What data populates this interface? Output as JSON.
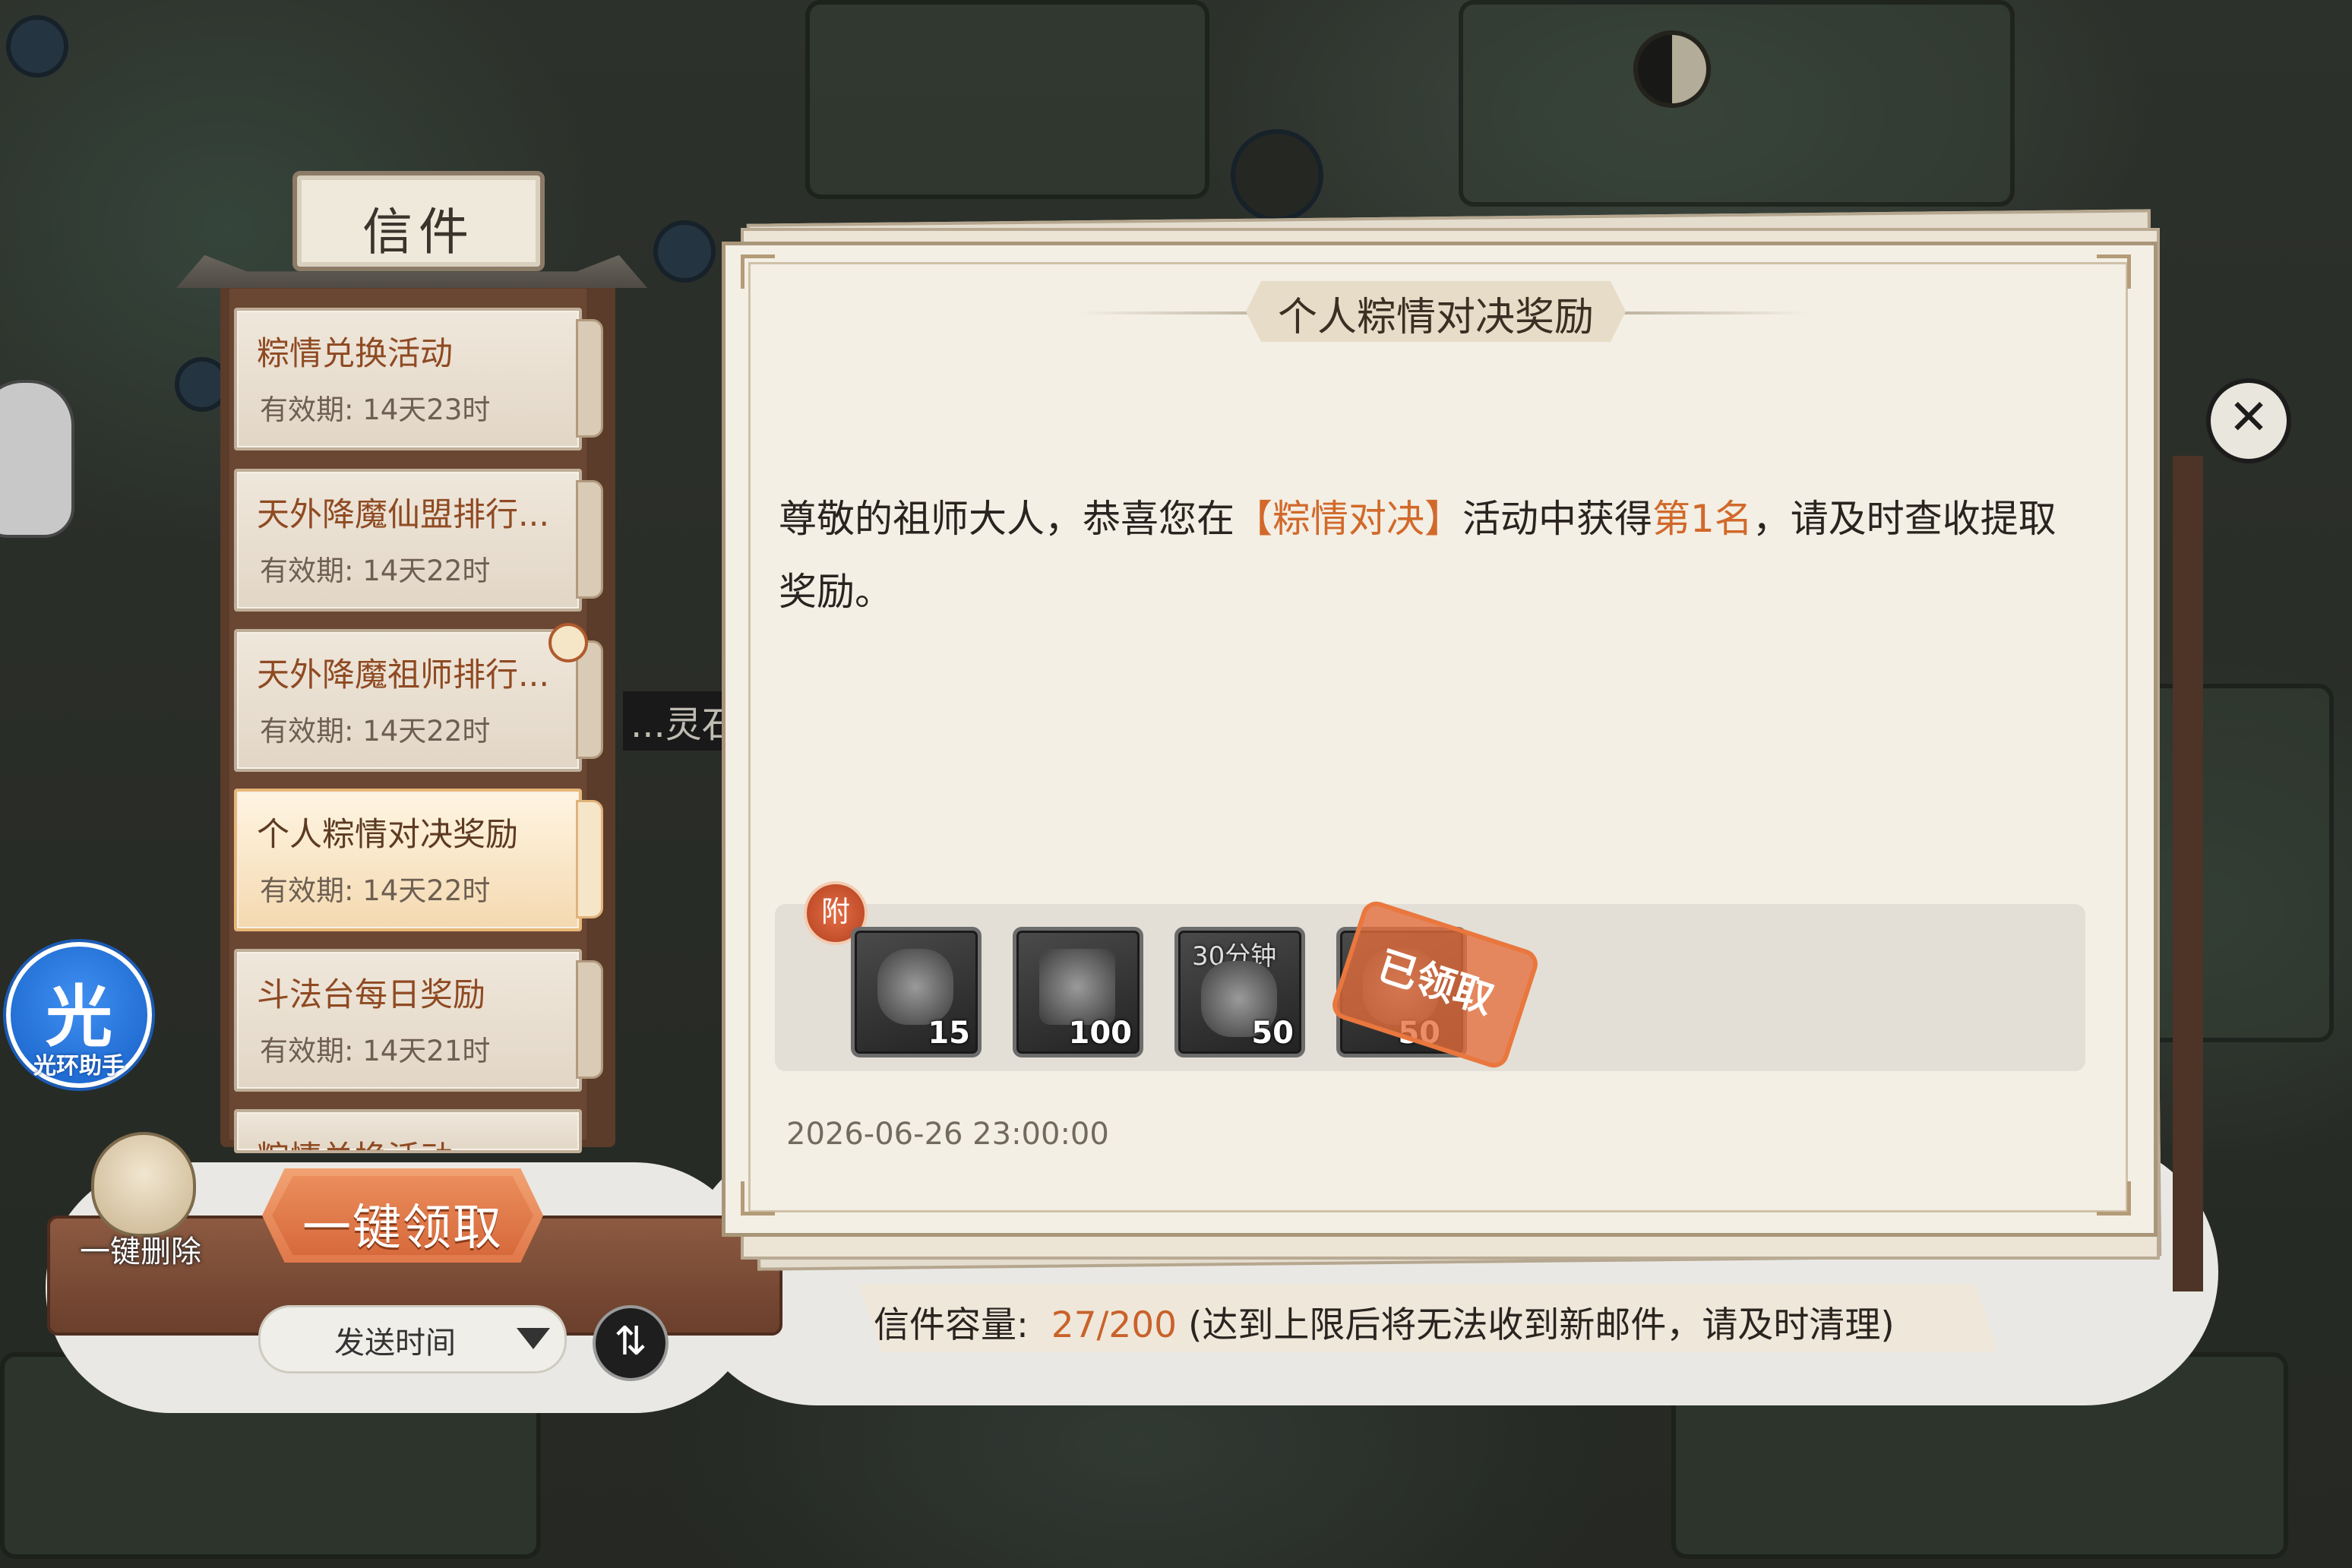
{
  "mailbox": {
    "title": "信件",
    "mails": [
      {
        "title": "粽情兑换活动",
        "validity": "有效期: 14天23时",
        "has_attachment": false,
        "selected": false
      },
      {
        "title": "天外降魔仙盟排行...",
        "validity": "有效期: 14天22时",
        "has_attachment": false,
        "selected": false
      },
      {
        "title": "天外降魔祖师排行...",
        "validity": "有效期: 14天22时",
        "has_attachment": true,
        "selected": false
      },
      {
        "title": "个人粽情对决奖励",
        "validity": "有效期: 14天22时",
        "has_attachment": false,
        "selected": true
      },
      {
        "title": "斗法台每日奖励",
        "validity": "有效期: 14天21时",
        "has_attachment": false,
        "selected": false
      },
      {
        "title": "粽情兑换活动",
        "validity": "",
        "has_attachment": false,
        "selected": false
      }
    ],
    "claim_all_label": "一键领取",
    "delete_all_label": "一键删除",
    "sort_label": "发送时间",
    "sort_toggle_icon": "⇅"
  },
  "letter": {
    "title": "个人粽情对决奖励",
    "body_prefix": "尊敬的祖师大人，恭喜您在",
    "event_name": "【粽情对决】",
    "body_mid": "活动中获得",
    "rank": "第1名",
    "body_suffix": "，请及时查收提取奖励。",
    "attachment_badge": "附",
    "attachments": [
      {
        "icon": "beast-head-icon",
        "count": "15",
        "top_label": ""
      },
      {
        "icon": "treasure-chest-icon",
        "count": "100",
        "top_label": ""
      },
      {
        "icon": "time-boost-icon",
        "count": "50",
        "top_label": "30分钟"
      },
      {
        "icon": "item-icon",
        "count": "50",
        "top_label": ""
      }
    ],
    "claimed_stamp": "已领取",
    "date": "2026-06-26 23:00:00",
    "close_icon": "✕"
  },
  "capacity": {
    "label": "信件容量:",
    "value": "27/200",
    "note": "(达到上限后将无法收到新邮件，请及时清理)"
  },
  "side": {
    "assistant_char": "光",
    "assistant_label": "光环助手",
    "bg_sign_1": "...灵石"
  },
  "colors": {
    "accent_orange": "#d2692a",
    "paper": "#f3efe5",
    "wood": "#5b3b2a"
  }
}
